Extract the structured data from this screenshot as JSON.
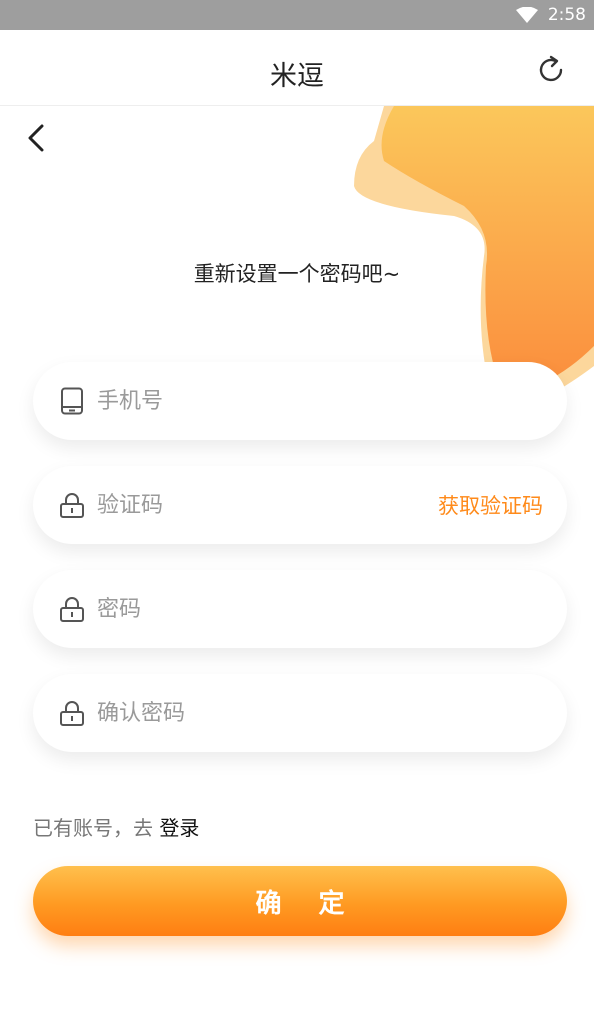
{
  "status_bar": {
    "time": "2:58",
    "wifi_icon": "wifi-icon"
  },
  "header": {
    "title": "米逗",
    "refresh_icon": "refresh-icon",
    "back_icon": "back-arrow-icon"
  },
  "subtitle": "重新设置一个密码吧~",
  "form": {
    "phone": {
      "placeholder": "手机号",
      "value": "",
      "icon": "phone-icon"
    },
    "code": {
      "placeholder": "验证码",
      "value": "",
      "icon": "lock-icon",
      "get_code_label": "获取验证码"
    },
    "password": {
      "placeholder": "密码",
      "value": "",
      "icon": "lock-icon"
    },
    "confirm_password": {
      "placeholder": "确认密码",
      "value": "",
      "icon": "lock-icon"
    }
  },
  "login_hint": {
    "text": "已有账号，去 ",
    "link": "登录"
  },
  "confirm_button": "确 定",
  "colors": {
    "accent": "#ff8a1a",
    "gradient_top": "#ffc04d",
    "gradient_bottom": "#ff7e12",
    "status_bar": "#9e9e9e"
  }
}
